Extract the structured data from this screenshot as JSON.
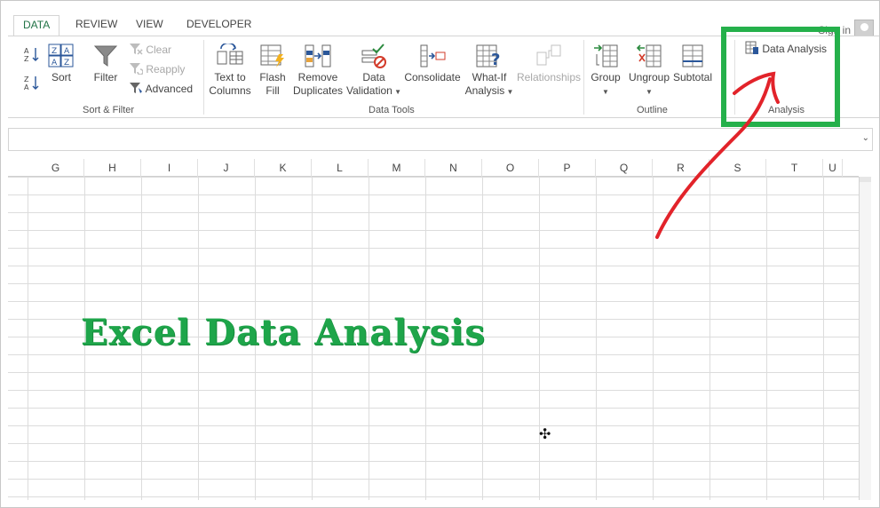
{
  "tabs": [
    {
      "label": "DATA",
      "active": true
    },
    {
      "label": "REVIEW"
    },
    {
      "label": "VIEW"
    },
    {
      "label": "DEVELOPER"
    }
  ],
  "account": {
    "sign_in": "Sign in"
  },
  "ribbon": {
    "sort_filter": {
      "sort": "Sort",
      "filter": "Filter",
      "clear": "Clear",
      "reapply": "Reapply",
      "advanced": "Advanced",
      "group_label": "Sort & Filter"
    },
    "data_tools": {
      "text_to_columns": [
        "Text to",
        "Columns"
      ],
      "flash_fill": [
        "Flash",
        "Fill"
      ],
      "remove_duplicates": [
        "Remove",
        "Duplicates"
      ],
      "data_validation": [
        "Data",
        "Validation"
      ],
      "consolidate": "Consolidate",
      "what_if": [
        "What-If",
        "Analysis"
      ],
      "relationships": "Relationships",
      "group_label": "Data Tools"
    },
    "outline": {
      "group": "Group",
      "ungroup": "Ungroup",
      "subtotal": "Subtotal",
      "group_label": "Outline"
    },
    "analysis": {
      "data_analysis": "Data Analysis",
      "group_label": "Analysis"
    }
  },
  "columns": [
    "G",
    "H",
    "I",
    "J",
    "K",
    "L",
    "M",
    "N",
    "O",
    "P",
    "Q",
    "R",
    "S",
    "T",
    "U"
  ],
  "overlay": {
    "title": "Excel Data Analysis"
  },
  "colors": {
    "accent": "#217346",
    "highlight": "#25b04b",
    "arrow": "#e2232a",
    "title": "#1ea54a"
  }
}
